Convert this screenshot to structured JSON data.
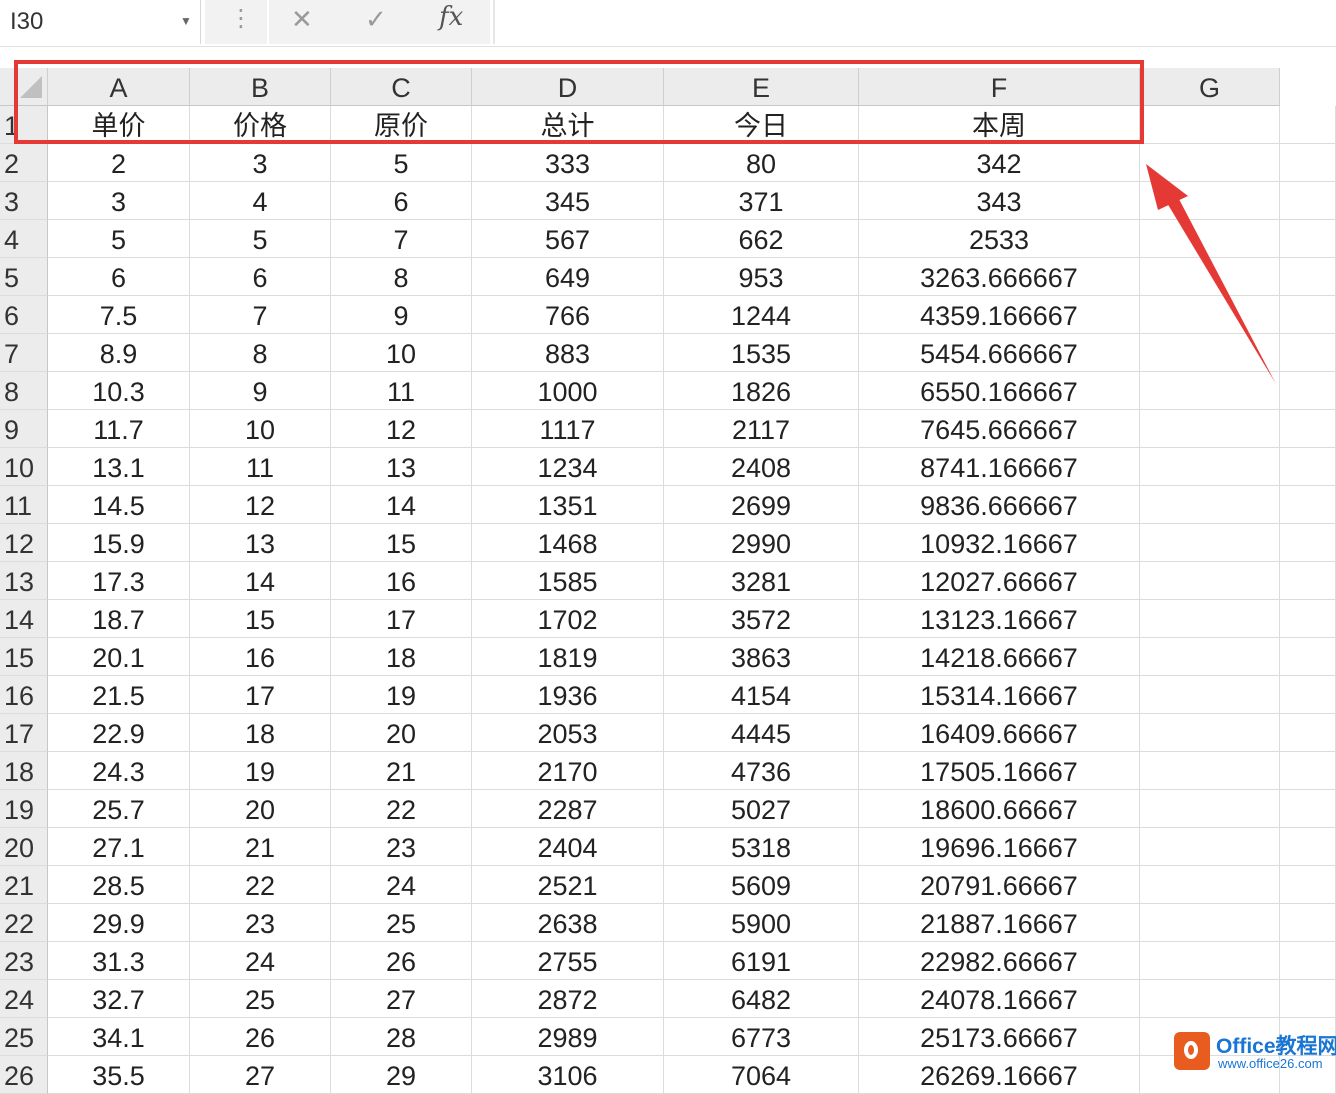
{
  "formula_bar": {
    "name_box": "I30",
    "cancel_icon": "✕",
    "enter_icon": "✓",
    "fx_label": "fx",
    "more_icon": "⋮"
  },
  "columns": [
    "A",
    "B",
    "C",
    "D",
    "E",
    "F",
    "G"
  ],
  "rows": [
    {
      "n": "1",
      "cells": [
        "单价",
        "价格",
        "原价",
        "总计",
        "今日",
        "本周",
        ""
      ]
    },
    {
      "n": "2",
      "cells": [
        "2",
        "3",
        "5",
        "333",
        "80",
        "342",
        ""
      ]
    },
    {
      "n": "3",
      "cells": [
        "3",
        "4",
        "6",
        "345",
        "371",
        "343",
        ""
      ]
    },
    {
      "n": "4",
      "cells": [
        "5",
        "5",
        "7",
        "567",
        "662",
        "2533",
        ""
      ]
    },
    {
      "n": "5",
      "cells": [
        "6",
        "6",
        "8",
        "649",
        "953",
        "3263.666667",
        ""
      ]
    },
    {
      "n": "6",
      "cells": [
        "7.5",
        "7",
        "9",
        "766",
        "1244",
        "4359.166667",
        ""
      ]
    },
    {
      "n": "7",
      "cells": [
        "8.9",
        "8",
        "10",
        "883",
        "1535",
        "5454.666667",
        ""
      ]
    },
    {
      "n": "8",
      "cells": [
        "10.3",
        "9",
        "11",
        "1000",
        "1826",
        "6550.166667",
        ""
      ]
    },
    {
      "n": "9",
      "cells": [
        "11.7",
        "10",
        "12",
        "1117",
        "2117",
        "7645.666667",
        ""
      ]
    },
    {
      "n": "10",
      "cells": [
        "13.1",
        "11",
        "13",
        "1234",
        "2408",
        "8741.166667",
        ""
      ]
    },
    {
      "n": "11",
      "cells": [
        "14.5",
        "12",
        "14",
        "1351",
        "2699",
        "9836.666667",
        ""
      ]
    },
    {
      "n": "12",
      "cells": [
        "15.9",
        "13",
        "15",
        "1468",
        "2990",
        "10932.16667",
        ""
      ]
    },
    {
      "n": "13",
      "cells": [
        "17.3",
        "14",
        "16",
        "1585",
        "3281",
        "12027.66667",
        ""
      ]
    },
    {
      "n": "14",
      "cells": [
        "18.7",
        "15",
        "17",
        "1702",
        "3572",
        "13123.16667",
        ""
      ]
    },
    {
      "n": "15",
      "cells": [
        "20.1",
        "16",
        "18",
        "1819",
        "3863",
        "14218.66667",
        ""
      ]
    },
    {
      "n": "16",
      "cells": [
        "21.5",
        "17",
        "19",
        "1936",
        "4154",
        "15314.16667",
        ""
      ]
    },
    {
      "n": "17",
      "cells": [
        "22.9",
        "18",
        "20",
        "2053",
        "4445",
        "16409.66667",
        ""
      ]
    },
    {
      "n": "18",
      "cells": [
        "24.3",
        "19",
        "21",
        "2170",
        "4736",
        "17505.16667",
        ""
      ]
    },
    {
      "n": "19",
      "cells": [
        "25.7",
        "20",
        "22",
        "2287",
        "5027",
        "18600.66667",
        ""
      ]
    },
    {
      "n": "20",
      "cells": [
        "27.1",
        "21",
        "23",
        "2404",
        "5318",
        "19696.16667",
        ""
      ]
    },
    {
      "n": "21",
      "cells": [
        "28.5",
        "22",
        "24",
        "2521",
        "5609",
        "20791.66667",
        ""
      ]
    },
    {
      "n": "22",
      "cells": [
        "29.9",
        "23",
        "25",
        "2638",
        "5900",
        "21887.16667",
        ""
      ]
    },
    {
      "n": "23",
      "cells": [
        "31.3",
        "24",
        "26",
        "2755",
        "6191",
        "22982.66667",
        ""
      ]
    },
    {
      "n": "24",
      "cells": [
        "32.7",
        "25",
        "27",
        "2872",
        "6482",
        "24078.16667",
        ""
      ]
    },
    {
      "n": "25",
      "cells": [
        "34.1",
        "26",
        "28",
        "2989",
        "6773",
        "25173.66667",
        ""
      ]
    },
    {
      "n": "26",
      "cells": [
        "35.5",
        "27",
        "29",
        "3106",
        "7064",
        "26269.16667",
        ""
      ]
    }
  ],
  "annotation": {
    "color": "#e53935"
  },
  "watermark": {
    "title": "Office教程网",
    "url": "www.office26.com"
  }
}
